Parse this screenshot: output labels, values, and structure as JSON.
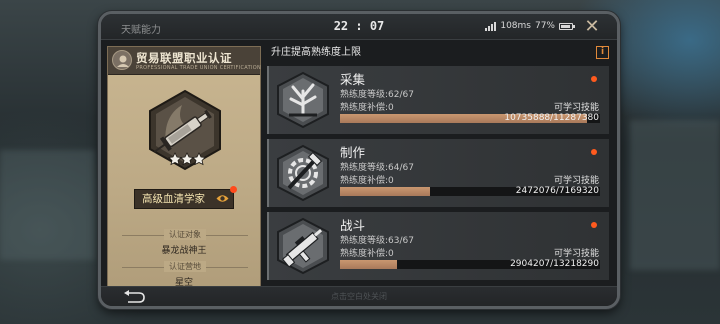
{
  "window": {
    "title": "天赋能力",
    "clock": "22 : 07",
    "network": "108ms",
    "battery": "77%",
    "close": "✕"
  },
  "certificate": {
    "title": "贸易联盟职业认证",
    "subtitle": "PROFESSIONAL TRADE UNION CERTIFICATION",
    "badge": "高级血清学家",
    "target_label": "认证对象",
    "target_value": "暴龙战神王",
    "camp_label": "认证营地",
    "camp_value": "星空",
    "stars": 3
  },
  "skills_header": {
    "label": "升庄提高熟练度上限",
    "info_icon": "i"
  },
  "skills": [
    {
      "name": "采集",
      "icon": "plant-tool-icon",
      "level": "熟练度等级:62/67",
      "compensation": "熟练度补偿:0",
      "learnable": "可学习技能",
      "xp": "10735888/11287380",
      "progress": 0.951
    },
    {
      "name": "制作",
      "icon": "gear-hammer-icon",
      "level": "熟练度等级:64/67",
      "compensation": "熟练度补偿:0",
      "learnable": "可学习技能",
      "xp": "2472076/7169320",
      "progress": 0.345
    },
    {
      "name": "战斗",
      "icon": "rifle-icon",
      "level": "熟练度等级:63/67",
      "compensation": "熟练度补偿:0",
      "learnable": "可学习技能",
      "xp": "2904207/13218290",
      "progress": 0.22
    }
  ],
  "bottom": {
    "hint": "点击空白处关闭"
  },
  "colors": {
    "accent": "#ff5a1e",
    "progress": "#c99770",
    "badge_text": "#f3e3b0"
  }
}
